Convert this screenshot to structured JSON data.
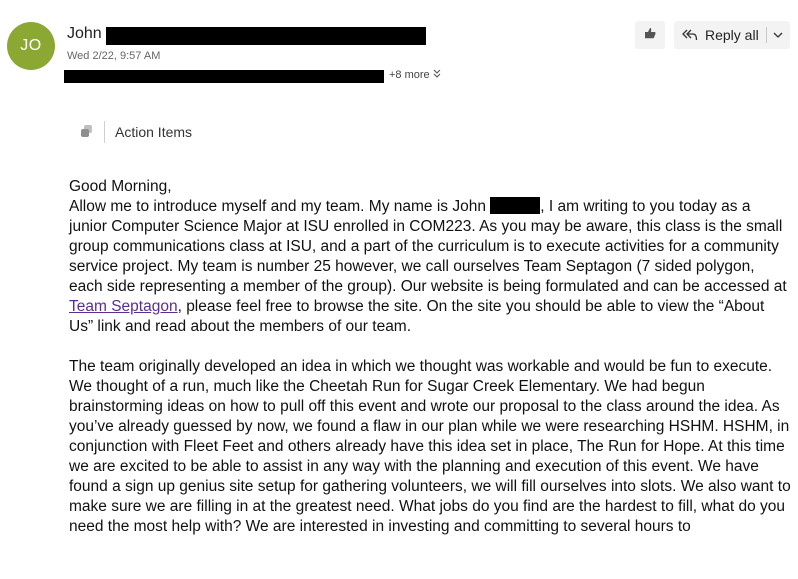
{
  "sender": {
    "initials": "JO",
    "first_name": "John",
    "date": "Wed 2/22, 9:57 AM",
    "more_recipients": "+8 more"
  },
  "toolbar": {
    "reply_all_label": "Reply all"
  },
  "action_items": {
    "label": "Action Items"
  },
  "message": {
    "greeting": "Good Morning,",
    "p1_a": "Allow me to introduce myself and my team.  My name is John ",
    "p1_b": ", I am writing to you today as a junior Computer Science Major at ISU enrolled in COM223.  As you may be aware, this class is the small group communications class at ISU, and a part of the curriculum is to execute activities for a community service project. My team is number 25 however, we call ourselves Team Septagon (7 sided polygon, each side representing a member of the group).  Our website is being formulated and can be accessed at ",
    "link_text": "Team Septagon",
    "p1_c": ", please feel free to browse the site.  On the site you should be able to view the “About Us” link and read about the members of our team.",
    "p2": "The team originally developed an idea in which we thought was workable and would be fun to execute.  We thought of a run, much like the Cheetah Run for Sugar Creek Elementary.  We had begun brainstorming ideas on how to pull off this event and wrote our proposal to the class around the idea.  As you’ve already guessed by now, we found a flaw in our plan while we were researching HSHM.  HSHM, in conjunction with Fleet Feet and others already have this idea set in place, The Run for Hope.  At this time we are excited to be able to assist in any way with the planning and execution of this event.  We have found a sign up genius site setup for gathering volunteers, we will fill ourselves into slots. We also want to make sure we are filling in at the greatest need.  What jobs do you find are the hardest to fill, what do you need the most help with?  We are interested in investing and committing to several hours to"
  },
  "colors": {
    "avatar_bg": "#8aa832",
    "link": "#5b2e91",
    "button_bg": "#f3f3f3"
  },
  "icons": [
    "react-icon",
    "reply-all-icon",
    "chevron-down-icon",
    "double-chevron-down-icon",
    "action-items-icon"
  ]
}
